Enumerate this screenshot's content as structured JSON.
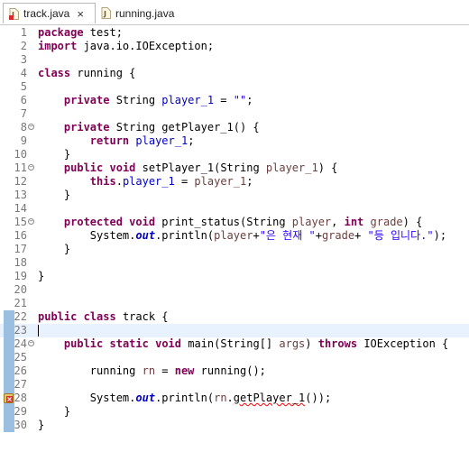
{
  "tabs": [
    {
      "label": "track.java",
      "active": true,
      "close": "×"
    },
    {
      "label": "running.java",
      "active": false
    }
  ],
  "editor": {
    "lines": [
      {
        "n": "1",
        "seg": [
          [
            "kw",
            "package"
          ],
          [
            "plain",
            " test;"
          ]
        ]
      },
      {
        "n": "2",
        "seg": [
          [
            "kw",
            "import"
          ],
          [
            "plain",
            " java.io.IOException;"
          ]
        ]
      },
      {
        "n": "3",
        "seg": []
      },
      {
        "n": "4",
        "seg": [
          [
            "kw",
            "class"
          ],
          [
            "plain",
            " running {"
          ]
        ]
      },
      {
        "n": "5",
        "seg": []
      },
      {
        "n": "6",
        "seg": [
          [
            "plain",
            "    "
          ],
          [
            "kw",
            "private"
          ],
          [
            "plain",
            " String "
          ],
          [
            "fld",
            "player_1"
          ],
          [
            "plain",
            " = "
          ],
          [
            "str",
            "\"\""
          ],
          [
            "plain",
            ";"
          ]
        ]
      },
      {
        "n": "7",
        "seg": []
      },
      {
        "n": "8",
        "fold": true,
        "seg": [
          [
            "plain",
            "    "
          ],
          [
            "kw",
            "private"
          ],
          [
            "plain",
            " String getPlayer_1() {"
          ]
        ]
      },
      {
        "n": "9",
        "seg": [
          [
            "plain",
            "        "
          ],
          [
            "kw",
            "return"
          ],
          [
            "plain",
            " "
          ],
          [
            "fld",
            "player_1"
          ],
          [
            "plain",
            ";"
          ]
        ]
      },
      {
        "n": "10",
        "seg": [
          [
            "plain",
            "    }"
          ]
        ]
      },
      {
        "n": "11",
        "fold": true,
        "seg": [
          [
            "plain",
            "    "
          ],
          [
            "kw",
            "public"
          ],
          [
            "plain",
            " "
          ],
          [
            "kw",
            "void"
          ],
          [
            "plain",
            " setPlayer_1(String "
          ],
          [
            "prm",
            "player_1"
          ],
          [
            "plain",
            ") {"
          ]
        ]
      },
      {
        "n": "12",
        "seg": [
          [
            "plain",
            "        "
          ],
          [
            "kw",
            "this"
          ],
          [
            "plain",
            "."
          ],
          [
            "fld",
            "player_1"
          ],
          [
            "plain",
            " = "
          ],
          [
            "prm",
            "player_1"
          ],
          [
            "plain",
            ";"
          ]
        ]
      },
      {
        "n": "13",
        "seg": [
          [
            "plain",
            "    }"
          ]
        ]
      },
      {
        "n": "14",
        "seg": []
      },
      {
        "n": "15",
        "fold": true,
        "seg": [
          [
            "plain",
            "    "
          ],
          [
            "kw",
            "protected"
          ],
          [
            "plain",
            " "
          ],
          [
            "kw",
            "void"
          ],
          [
            "plain",
            " print_status(String "
          ],
          [
            "prm",
            "player"
          ],
          [
            "plain",
            ", "
          ],
          [
            "kw",
            "int"
          ],
          [
            "plain",
            " "
          ],
          [
            "prm",
            "grade"
          ],
          [
            "plain",
            ") {"
          ]
        ]
      },
      {
        "n": "16",
        "seg": [
          [
            "plain",
            "        System."
          ],
          [
            "sfld",
            "out"
          ],
          [
            "plain",
            ".println("
          ],
          [
            "prm",
            "player"
          ],
          [
            "plain",
            "+"
          ],
          [
            "str",
            "\"은 현재 \""
          ],
          [
            "plain",
            "+"
          ],
          [
            "prm",
            "grade"
          ],
          [
            "plain",
            "+ "
          ],
          [
            "str",
            "\"등 입니다.\""
          ],
          [
            "plain",
            ");"
          ]
        ]
      },
      {
        "n": "17",
        "seg": [
          [
            "plain",
            "    }"
          ]
        ]
      },
      {
        "n": "18",
        "seg": []
      },
      {
        "n": "19",
        "seg": [
          [
            "plain",
            "}"
          ]
        ]
      },
      {
        "n": "20",
        "seg": []
      },
      {
        "n": "21",
        "seg": []
      },
      {
        "n": "22",
        "mark": true,
        "seg": [
          [
            "kw",
            "public"
          ],
          [
            "plain",
            " "
          ],
          [
            "kw",
            "class"
          ],
          [
            "plain",
            " track {"
          ]
        ]
      },
      {
        "n": "23",
        "mark": true,
        "current": true,
        "seg": []
      },
      {
        "n": "24",
        "mark": true,
        "fold": true,
        "seg": [
          [
            "plain",
            "    "
          ],
          [
            "kw",
            "public"
          ],
          [
            "plain",
            " "
          ],
          [
            "kw",
            "static"
          ],
          [
            "plain",
            " "
          ],
          [
            "kw",
            "void"
          ],
          [
            "plain",
            " main(String[] "
          ],
          [
            "prm",
            "args"
          ],
          [
            "plain",
            ") "
          ],
          [
            "kw",
            "throws"
          ],
          [
            "plain",
            " IOException {"
          ]
        ]
      },
      {
        "n": "25",
        "mark": true,
        "seg": []
      },
      {
        "n": "26",
        "mark": true,
        "seg": [
          [
            "plain",
            "        running "
          ],
          [
            "prm",
            "rn"
          ],
          [
            "plain",
            " = "
          ],
          [
            "kw",
            "new"
          ],
          [
            "plain",
            " running();"
          ]
        ]
      },
      {
        "n": "27",
        "mark": true,
        "seg": []
      },
      {
        "n": "28",
        "mark": true,
        "error": true,
        "seg": [
          [
            "plain",
            "        System."
          ],
          [
            "sfld",
            "out"
          ],
          [
            "plain",
            ".println("
          ],
          [
            "prm",
            "rn"
          ],
          [
            "plain",
            "."
          ],
          [
            "err",
            "getPlayer_1"
          ],
          [
            "plain",
            "());"
          ]
        ]
      },
      {
        "n": "29",
        "mark": true,
        "seg": [
          [
            "plain",
            "    }"
          ]
        ]
      },
      {
        "n": "30",
        "mark": true,
        "seg": [
          [
            "plain",
            "}"
          ]
        ]
      }
    ]
  }
}
